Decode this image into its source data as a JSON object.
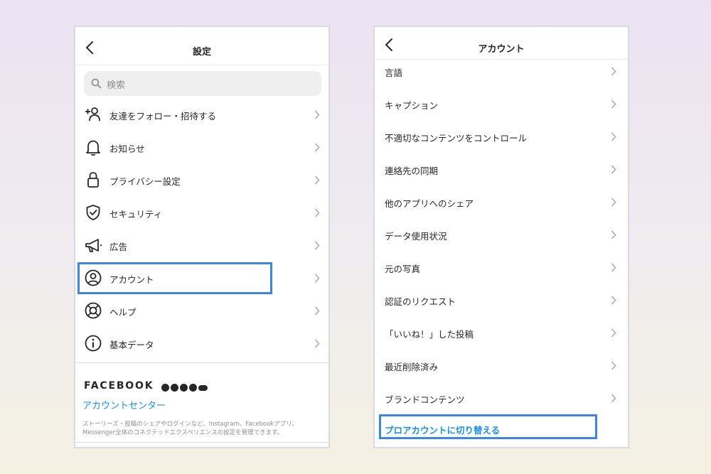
{
  "colors": {
    "link": "#1a8cf0",
    "highlight": "#3b86e0",
    "text": "#262626"
  },
  "settings": {
    "title": "設定",
    "search_placeholder": "検索",
    "items": [
      {
        "icon": "add-person-icon",
        "label": "友達をフォロー・招待する"
      },
      {
        "icon": "bell-icon",
        "label": "お知らせ"
      },
      {
        "icon": "lock-icon",
        "label": "プライバシー設定"
      },
      {
        "icon": "shield-icon",
        "label": "セキュリティ"
      },
      {
        "icon": "megaphone-icon",
        "label": "広告"
      },
      {
        "icon": "user-circle-icon",
        "label": "アカウント"
      },
      {
        "icon": "lifebuoy-icon",
        "label": "ヘルプ"
      },
      {
        "icon": "info-icon",
        "label": "基本データ"
      }
    ],
    "facebook": {
      "wordmark": "FACEBOOK",
      "icons": [
        "facebook-icon",
        "messenger-icon",
        "instagram-icon",
        "whatsapp-icon",
        "portal-icon"
      ],
      "link": "アカウントセンター",
      "description": "ストーリーズ・投稿のシェアやログインなど、Instagram、Facebookアプリ、Messenger全体のコネクテッドエクスペリエンスの設定を管理できます。"
    }
  },
  "account": {
    "title": "アカウント",
    "items": [
      "言語",
      "キャプション",
      "不適切なコンテンツをコントロール",
      "連絡先の同期",
      "他のアプリへのシェア",
      "データ使用状況",
      "元の写真",
      "認証のリクエスト",
      "「いいね！」した投稿",
      "最近削除済み",
      "ブランドコンテンツ"
    ],
    "switch_link": "プロアカウントに切り替える"
  }
}
